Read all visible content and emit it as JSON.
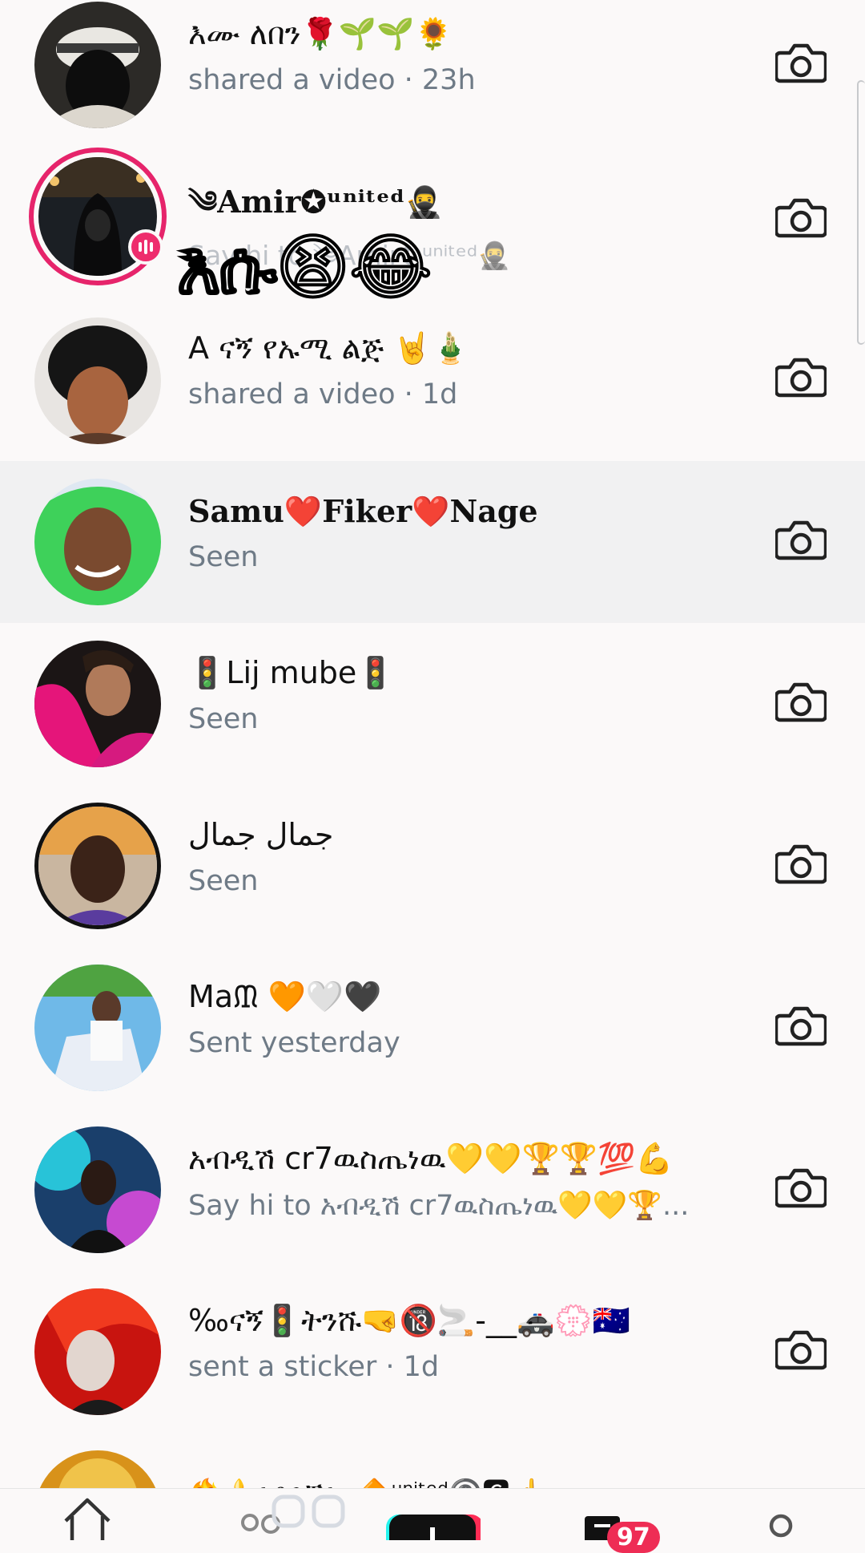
{
  "chats": [
    {
      "name": "እሙ ለበን🌹🌱🌱🌻",
      "status": "shared a video · 23h"
    },
    {
      "name": "༄Amir✪ᵘⁿⁱᵗᵉᵈ🥷",
      "status": "Say hi to ༄Amir✪ᵘⁿⁱᵗᵉᵈ🥷"
    },
    {
      "name": "A ናኝ የኡሚ ልጅ 🤘🎍",
      "status": "shared a video · 1d"
    },
    {
      "name": "Samu❤️Fiker❤️Nage",
      "status": "Seen"
    },
    {
      "name": "🚦Lij mube🚦",
      "status": "Seen"
    },
    {
      "name": "جمال جمال",
      "status": "Seen"
    },
    {
      "name": "Maᙢ 🧡🤍🖤",
      "status": "Sent yesterday"
    },
    {
      "name": "አብዲሽ cr7ዉስጤነዉ💛💛🏆🏆💯💪",
      "status": "Say hi to አብዲሽ cr7ዉስጤነዉ💛💛🏆..."
    },
    {
      "name": "‰ናኝ🚦ትንሹ🤜🔞🚬-__🚓💮🇦🇺",
      "status": "sent a sticker · 1d"
    },
    {
      "name": "❤️‍🔥⚜️፥ቆንጆ፥ዑ🔶ᵘⁿⁱᵗᵉᵈ©️🅲☝️",
      "status": ""
    }
  ],
  "overlay_text": "እሱ😫😂",
  "nav": {
    "inbox_badge": "97"
  },
  "colors": {
    "story_ring": "#e6246b",
    "badge": "#ee2d55",
    "secondary_text": "#6e7a86"
  }
}
